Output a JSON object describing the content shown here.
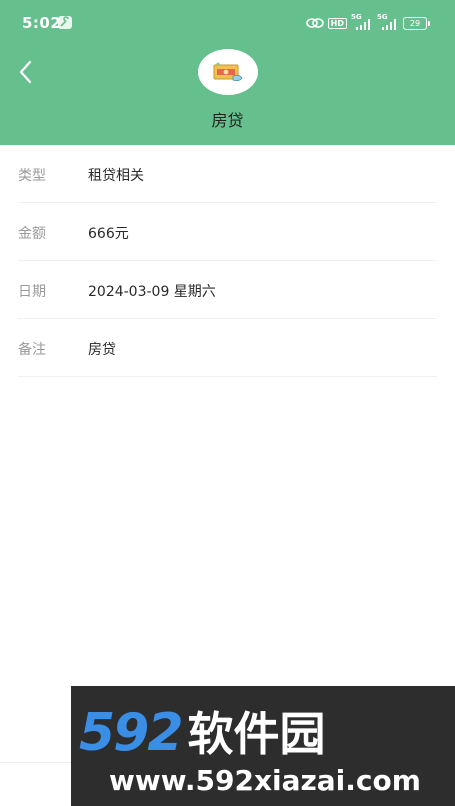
{
  "status_bar": {
    "time": "5:02",
    "hd_label": "HD",
    "sim1_label": "5G",
    "sim2_label": "5G",
    "battery_level": "29"
  },
  "header": {
    "title": "房贷",
    "icon": "money-bill-icon",
    "background_color": "#66c08d"
  },
  "details": [
    {
      "label": "类型",
      "value": "租贷相关"
    },
    {
      "label": "金额",
      "value": "666元"
    },
    {
      "label": "日期",
      "value": "2024-03-09 星期六"
    },
    {
      "label": "备注",
      "value": "房贷"
    }
  ],
  "watermark": {
    "brand_number": "592",
    "brand_name": "软件园",
    "url": "www.592xiazai.com"
  }
}
